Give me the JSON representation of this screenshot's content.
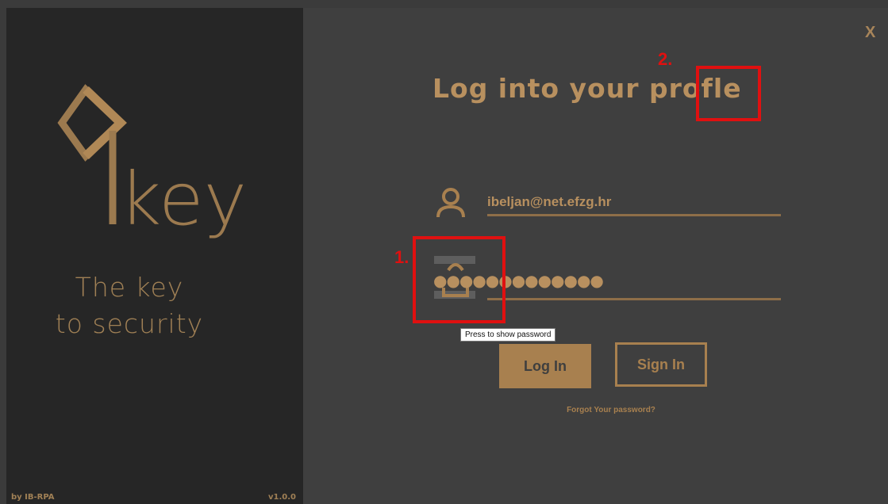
{
  "brand": {
    "wordmark": "key",
    "tagline_line1": "The key",
    "tagline_line2": "to security",
    "author": "by IB-RPA",
    "version": "v1.0.0"
  },
  "window": {
    "close_label": "X"
  },
  "login": {
    "title": "Log into your profle",
    "email_value": "ibeljan@net.efzg.hr",
    "password_mask": "●●●●●●●●●●●●●",
    "show_password_tooltip": "Press to show password",
    "login_button": "Log In",
    "signin_button": "Sign In",
    "forgot_link": "Forgot Your password?"
  },
  "annotations": [
    {
      "label": "1."
    },
    {
      "label": "2."
    }
  ],
  "icons": {
    "user": "user-icon",
    "lock": "lock-icon",
    "logo": "key-logo-icon"
  },
  "colors": {
    "accent": "#a8804f",
    "left_panel": "#262626",
    "right_panel": "#3f3f3f",
    "annotation": "#e01010"
  }
}
